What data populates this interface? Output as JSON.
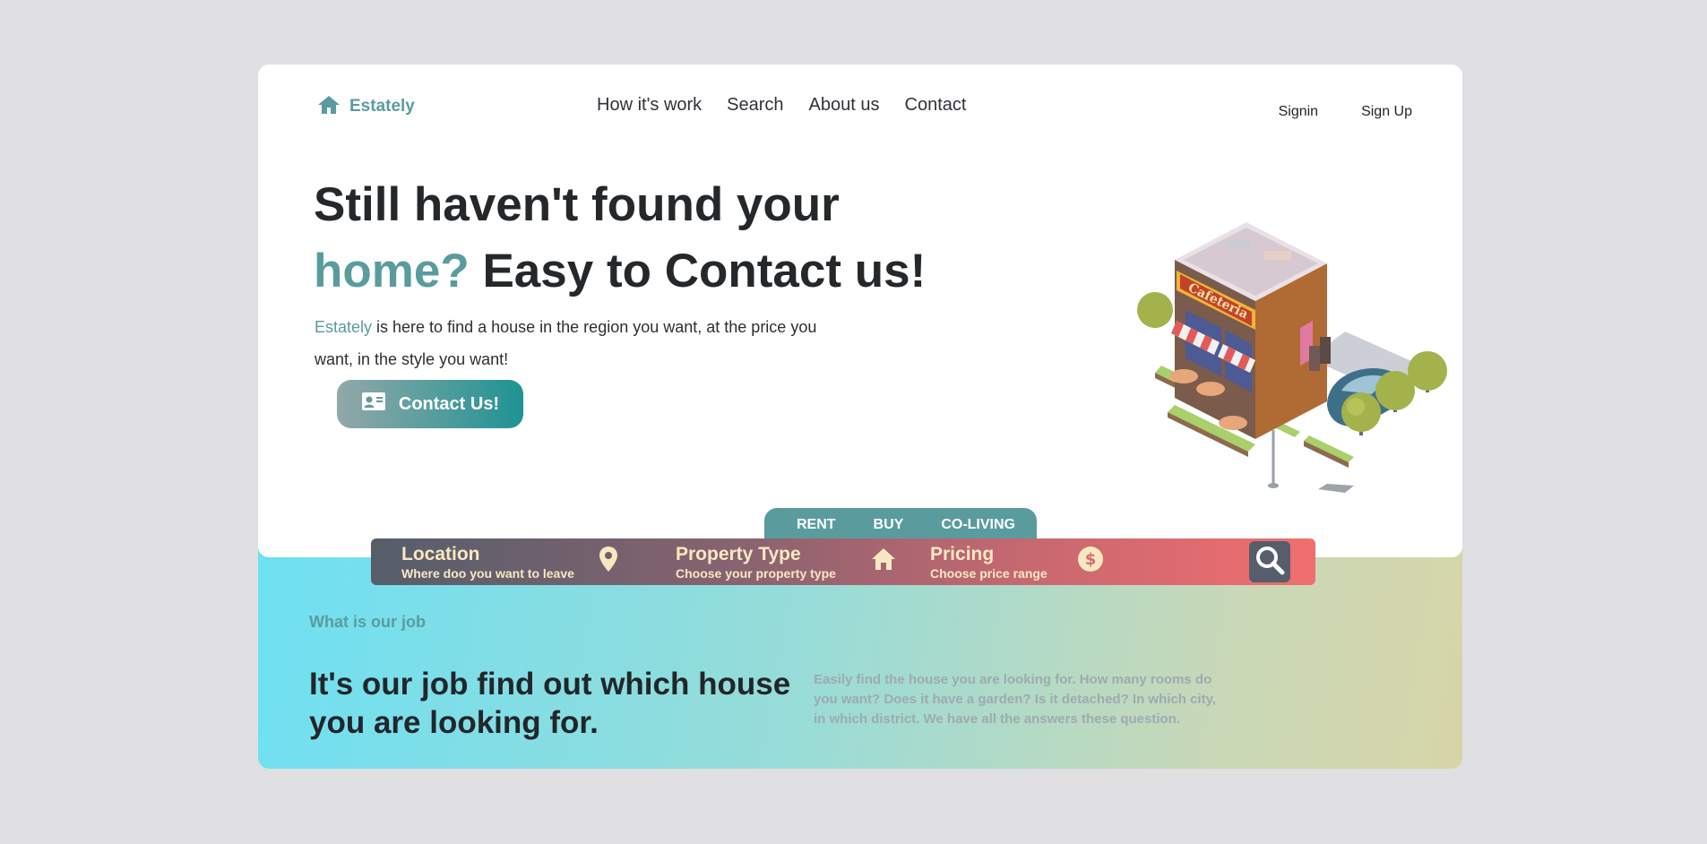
{
  "header": {
    "logo_text": "Estately",
    "nav": [
      "How it's work",
      "Search",
      "About us",
      "Contact"
    ],
    "signin": "Signin",
    "signup": "Sign Up"
  },
  "hero": {
    "title_line1": "Still haven't found your",
    "title_accent": "home?",
    "title_rest": " Easy to Contact us!",
    "desc_brand": "Estately",
    "desc_text": " is here to find a house in the region you want, at the price you want, in the style you want!",
    "contact_button": "Contact Us!",
    "illustration_sign": "Cafeteria"
  },
  "search": {
    "tabs": [
      "RENT",
      "BUY",
      "CO-LIVING"
    ],
    "location_label": "Location",
    "location_sub": "Where doo you want to leave",
    "property_label": "Property Type",
    "property_sub": "Choose your property type",
    "pricing_label": "Pricing",
    "pricing_sub": "Choose price range"
  },
  "job": {
    "eyebrow": "What is our job",
    "title": "It's our job find out which house you are looking for.",
    "desc": "Easily find the house you are looking for. How many rooms do you want? Does it have a garden? Is it detached? In which city, in which district. We have all the answers these question."
  },
  "colors": {
    "accent": "#5a9c9e",
    "page_bg": "#e0dfe2",
    "search_start": "#555e6a",
    "search_end": "#f06e6f",
    "search_text": "#f8e8c2"
  },
  "icons": [
    "home-icon",
    "contact-card-icon",
    "location-pin-icon",
    "house-icon",
    "dollar-icon",
    "search-icon"
  ]
}
